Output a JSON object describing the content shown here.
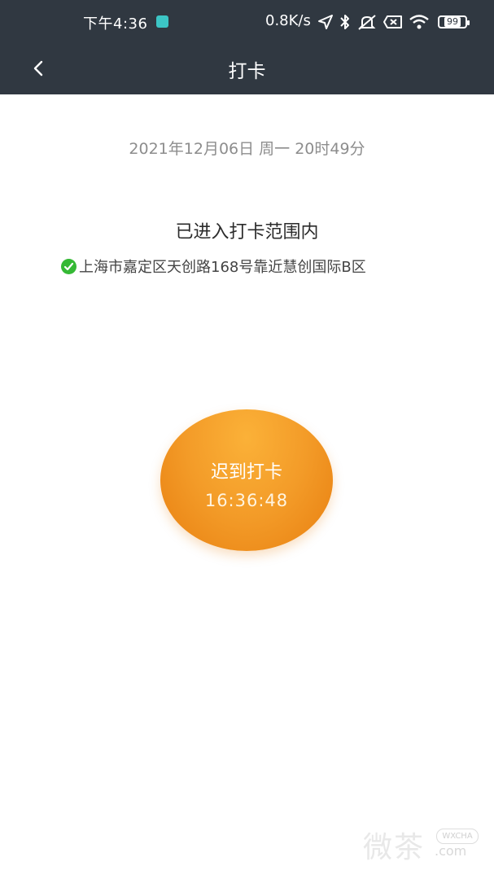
{
  "status_bar": {
    "time": "下午4:36",
    "network_speed": "0.8K/s",
    "battery": "99",
    "icons": [
      "location-arrow-icon",
      "bluetooth-icon",
      "mute-icon",
      "sim-off-icon",
      "wifi-icon",
      "battery-icon"
    ],
    "app_icon_color": "#3cc5c5"
  },
  "header": {
    "title": "打卡",
    "background_color": "#303841"
  },
  "main": {
    "datetime": "2021年12月06日 周一 20时49分",
    "range_status": "已进入打卡范围内",
    "address": "上海市嘉定区天创路168号靠近慧创国际B区",
    "check_color": "#35b935"
  },
  "punch_button": {
    "label": "迟到打卡",
    "time": "16:36:48",
    "color": "#f39b28"
  },
  "watermark": {
    "text": "微茶",
    "badge": "WXCHA",
    "sub": ".com"
  }
}
